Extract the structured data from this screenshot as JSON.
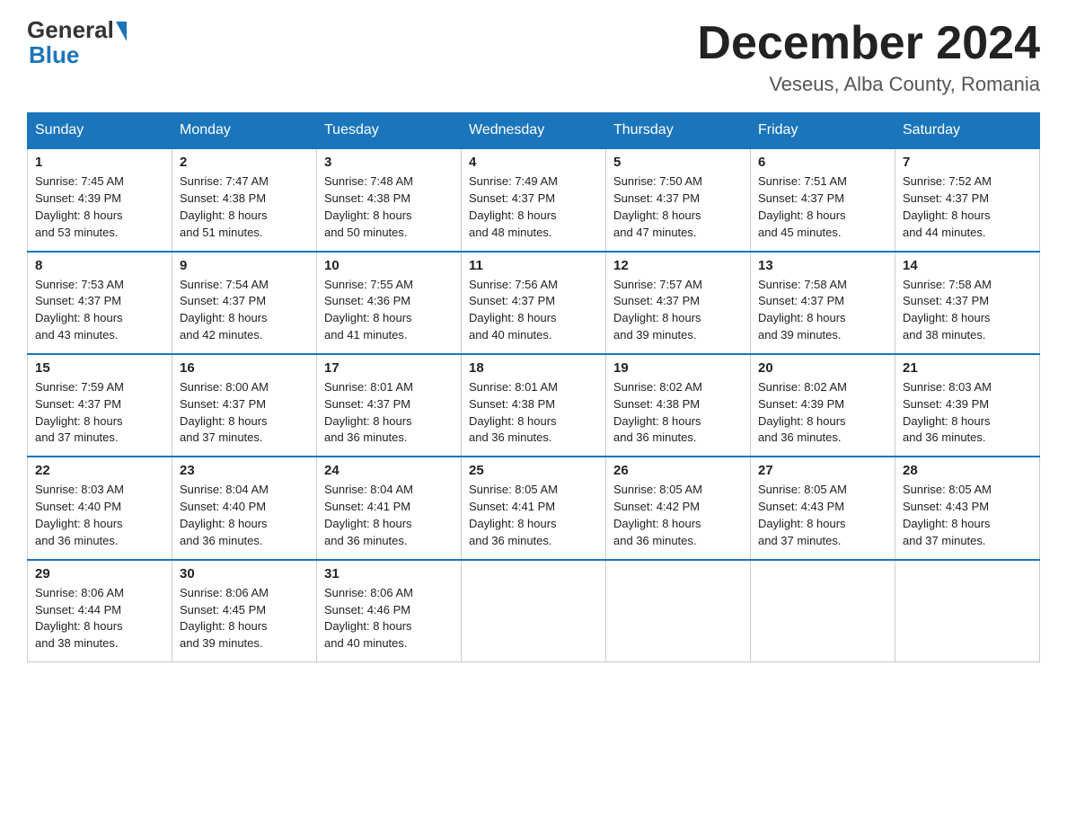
{
  "header": {
    "logo_general": "General",
    "logo_blue": "Blue",
    "month_title": "December 2024",
    "location": "Veseus, Alba County, Romania"
  },
  "days_of_week": [
    "Sunday",
    "Monday",
    "Tuesday",
    "Wednesday",
    "Thursday",
    "Friday",
    "Saturday"
  ],
  "weeks": [
    [
      {
        "day": "1",
        "sunrise": "Sunrise: 7:45 AM",
        "sunset": "Sunset: 4:39 PM",
        "daylight": "Daylight: 8 hours",
        "daylight2": "and 53 minutes."
      },
      {
        "day": "2",
        "sunrise": "Sunrise: 7:47 AM",
        "sunset": "Sunset: 4:38 PM",
        "daylight": "Daylight: 8 hours",
        "daylight2": "and 51 minutes."
      },
      {
        "day": "3",
        "sunrise": "Sunrise: 7:48 AM",
        "sunset": "Sunset: 4:38 PM",
        "daylight": "Daylight: 8 hours",
        "daylight2": "and 50 minutes."
      },
      {
        "day": "4",
        "sunrise": "Sunrise: 7:49 AM",
        "sunset": "Sunset: 4:37 PM",
        "daylight": "Daylight: 8 hours",
        "daylight2": "and 48 minutes."
      },
      {
        "day": "5",
        "sunrise": "Sunrise: 7:50 AM",
        "sunset": "Sunset: 4:37 PM",
        "daylight": "Daylight: 8 hours",
        "daylight2": "and 47 minutes."
      },
      {
        "day": "6",
        "sunrise": "Sunrise: 7:51 AM",
        "sunset": "Sunset: 4:37 PM",
        "daylight": "Daylight: 8 hours",
        "daylight2": "and 45 minutes."
      },
      {
        "day": "7",
        "sunrise": "Sunrise: 7:52 AM",
        "sunset": "Sunset: 4:37 PM",
        "daylight": "Daylight: 8 hours",
        "daylight2": "and 44 minutes."
      }
    ],
    [
      {
        "day": "8",
        "sunrise": "Sunrise: 7:53 AM",
        "sunset": "Sunset: 4:37 PM",
        "daylight": "Daylight: 8 hours",
        "daylight2": "and 43 minutes."
      },
      {
        "day": "9",
        "sunrise": "Sunrise: 7:54 AM",
        "sunset": "Sunset: 4:37 PM",
        "daylight": "Daylight: 8 hours",
        "daylight2": "and 42 minutes."
      },
      {
        "day": "10",
        "sunrise": "Sunrise: 7:55 AM",
        "sunset": "Sunset: 4:36 PM",
        "daylight": "Daylight: 8 hours",
        "daylight2": "and 41 minutes."
      },
      {
        "day": "11",
        "sunrise": "Sunrise: 7:56 AM",
        "sunset": "Sunset: 4:37 PM",
        "daylight": "Daylight: 8 hours",
        "daylight2": "and 40 minutes."
      },
      {
        "day": "12",
        "sunrise": "Sunrise: 7:57 AM",
        "sunset": "Sunset: 4:37 PM",
        "daylight": "Daylight: 8 hours",
        "daylight2": "and 39 minutes."
      },
      {
        "day": "13",
        "sunrise": "Sunrise: 7:58 AM",
        "sunset": "Sunset: 4:37 PM",
        "daylight": "Daylight: 8 hours",
        "daylight2": "and 39 minutes."
      },
      {
        "day": "14",
        "sunrise": "Sunrise: 7:58 AM",
        "sunset": "Sunset: 4:37 PM",
        "daylight": "Daylight: 8 hours",
        "daylight2": "and 38 minutes."
      }
    ],
    [
      {
        "day": "15",
        "sunrise": "Sunrise: 7:59 AM",
        "sunset": "Sunset: 4:37 PM",
        "daylight": "Daylight: 8 hours",
        "daylight2": "and 37 minutes."
      },
      {
        "day": "16",
        "sunrise": "Sunrise: 8:00 AM",
        "sunset": "Sunset: 4:37 PM",
        "daylight": "Daylight: 8 hours",
        "daylight2": "and 37 minutes."
      },
      {
        "day": "17",
        "sunrise": "Sunrise: 8:01 AM",
        "sunset": "Sunset: 4:37 PM",
        "daylight": "Daylight: 8 hours",
        "daylight2": "and 36 minutes."
      },
      {
        "day": "18",
        "sunrise": "Sunrise: 8:01 AM",
        "sunset": "Sunset: 4:38 PM",
        "daylight": "Daylight: 8 hours",
        "daylight2": "and 36 minutes."
      },
      {
        "day": "19",
        "sunrise": "Sunrise: 8:02 AM",
        "sunset": "Sunset: 4:38 PM",
        "daylight": "Daylight: 8 hours",
        "daylight2": "and 36 minutes."
      },
      {
        "day": "20",
        "sunrise": "Sunrise: 8:02 AM",
        "sunset": "Sunset: 4:39 PM",
        "daylight": "Daylight: 8 hours",
        "daylight2": "and 36 minutes."
      },
      {
        "day": "21",
        "sunrise": "Sunrise: 8:03 AM",
        "sunset": "Sunset: 4:39 PM",
        "daylight": "Daylight: 8 hours",
        "daylight2": "and 36 minutes."
      }
    ],
    [
      {
        "day": "22",
        "sunrise": "Sunrise: 8:03 AM",
        "sunset": "Sunset: 4:40 PM",
        "daylight": "Daylight: 8 hours",
        "daylight2": "and 36 minutes."
      },
      {
        "day": "23",
        "sunrise": "Sunrise: 8:04 AM",
        "sunset": "Sunset: 4:40 PM",
        "daylight": "Daylight: 8 hours",
        "daylight2": "and 36 minutes."
      },
      {
        "day": "24",
        "sunrise": "Sunrise: 8:04 AM",
        "sunset": "Sunset: 4:41 PM",
        "daylight": "Daylight: 8 hours",
        "daylight2": "and 36 minutes."
      },
      {
        "day": "25",
        "sunrise": "Sunrise: 8:05 AM",
        "sunset": "Sunset: 4:41 PM",
        "daylight": "Daylight: 8 hours",
        "daylight2": "and 36 minutes."
      },
      {
        "day": "26",
        "sunrise": "Sunrise: 8:05 AM",
        "sunset": "Sunset: 4:42 PM",
        "daylight": "Daylight: 8 hours",
        "daylight2": "and 36 minutes."
      },
      {
        "day": "27",
        "sunrise": "Sunrise: 8:05 AM",
        "sunset": "Sunset: 4:43 PM",
        "daylight": "Daylight: 8 hours",
        "daylight2": "and 37 minutes."
      },
      {
        "day": "28",
        "sunrise": "Sunrise: 8:05 AM",
        "sunset": "Sunset: 4:43 PM",
        "daylight": "Daylight: 8 hours",
        "daylight2": "and 37 minutes."
      }
    ],
    [
      {
        "day": "29",
        "sunrise": "Sunrise: 8:06 AM",
        "sunset": "Sunset: 4:44 PM",
        "daylight": "Daylight: 8 hours",
        "daylight2": "and 38 minutes."
      },
      {
        "day": "30",
        "sunrise": "Sunrise: 8:06 AM",
        "sunset": "Sunset: 4:45 PM",
        "daylight": "Daylight: 8 hours",
        "daylight2": "and 39 minutes."
      },
      {
        "day": "31",
        "sunrise": "Sunrise: 8:06 AM",
        "sunset": "Sunset: 4:46 PM",
        "daylight": "Daylight: 8 hours",
        "daylight2": "and 40 minutes."
      },
      null,
      null,
      null,
      null
    ]
  ]
}
